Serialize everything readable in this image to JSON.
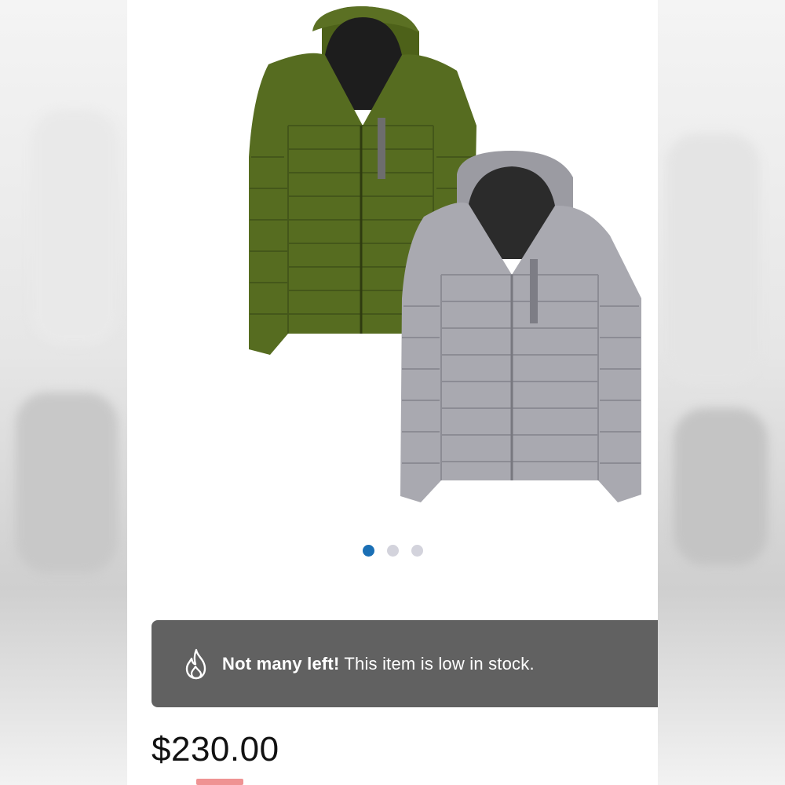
{
  "product": {
    "image_alt": "Two hooded quilted puffer jackets, olive green and grey",
    "carousel": {
      "total": 3,
      "active_index": 0
    },
    "colors": {
      "olive": "#556b1f",
      "grey": "#a7a7ae",
      "accent": "#1a6fb5"
    }
  },
  "stock_banner": {
    "icon": "flame-icon",
    "strong": "Not many left!",
    "text": " This item is low in stock."
  },
  "price": {
    "value": "$230.00"
  }
}
